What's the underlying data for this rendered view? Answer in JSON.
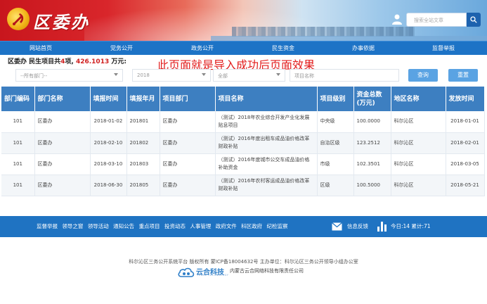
{
  "header": {
    "logo_text": "区委办",
    "search_placeholder": "搜索全站文章"
  },
  "nav": {
    "items": [
      {
        "label": "网站首页"
      },
      {
        "label": "党务公开"
      },
      {
        "label": "政务公开"
      },
      {
        "label": "民生资金"
      },
      {
        "label": "办事依据"
      },
      {
        "label": "监督举报"
      }
    ]
  },
  "summary": {
    "prefix": "区委办 民生项目共",
    "count": "4",
    "middle": "项,",
    "amount": "426.1013",
    "suffix": "万元:"
  },
  "notice": "此页面就是导入成功后页面效果",
  "filters": {
    "department": "--所有部门--",
    "year": "2018",
    "level": "全部",
    "name_placeholder": "项目名称",
    "query_button": "查询",
    "reset_button": "重置"
  },
  "table": {
    "headers": [
      "部门编码",
      "部门名称",
      "填报时间",
      "填报年月",
      "项目部门",
      "项目名称",
      "项目级别",
      "资金总数(万元)",
      "地区名称",
      "发放时间"
    ],
    "rows": [
      [
        "101",
        "区委办",
        "2018-01-02",
        "201801",
        "区委办",
        "（测试）2018年农业综合开发产业化发展贴息项目",
        "中央级",
        "100.0000",
        "科尔沁区",
        "2018-01-01"
      ],
      [
        "101",
        "区委办",
        "2018-02-10",
        "201802",
        "区委办",
        "（测试）2016年度出租车成品油价格改革财政补贴",
        "自治区级",
        "123.2512",
        "科尔沁区",
        "2018-02-01"
      ],
      [
        "101",
        "区委办",
        "2018-03-10",
        "201803",
        "区委办",
        "（测试）2016年度城市公交车成品油价格补助资金",
        "市级",
        "102.3501",
        "科尔沁区",
        "2018-03-05"
      ],
      [
        "101",
        "区委办",
        "2018-06-30",
        "201805",
        "区委办",
        "（测试）2016年农村客运成品油价格改革财政补贴",
        "区级",
        "100.5000",
        "科尔沁区",
        "2018-05-21"
      ]
    ]
  },
  "footer": {
    "links": [
      "监督举报",
      "领导之窗",
      "领导活动",
      "通知公告",
      "重点项目",
      "投资动态",
      "人事管理",
      "政府文件",
      "科区政府",
      "纪检监察"
    ],
    "feedback": "信息反馈",
    "stats": "今日:14 累计:71",
    "copyright": "科尔沁区三务公开系统平台 版权所有   蒙ICP备18004632号   主办单位：科尔沁区三务公开领导小组办公室",
    "brand_name": "云合科技",
    "brand_en": "YUNHE TECHNOLOGY",
    "brand_company": "内蒙古云合网络科技有限责任公司"
  },
  "colors": {
    "nav_blue": "#1d73c6",
    "header_row_blue": "#3d7fc1",
    "accent_red": "#d01f1f",
    "button_blue": "#5aa3e3"
  }
}
